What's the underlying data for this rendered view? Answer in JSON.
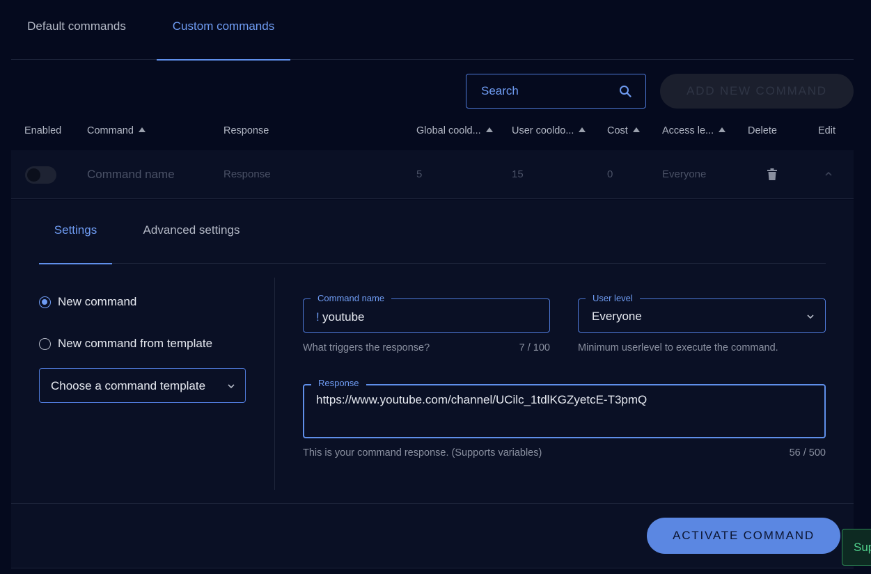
{
  "tabs": [
    "Default commands",
    "Custom commands"
  ],
  "search": {
    "placeholder": "Search"
  },
  "add_button": "ADD NEW COMMAND",
  "columns": [
    "Enabled",
    "Command",
    "Response",
    "Global coold...",
    "User cooldo...",
    "Cost",
    "Access le...",
    "Delete",
    "Edit"
  ],
  "row": {
    "enabled": false,
    "command": "Command name",
    "response": "Response",
    "global_cooldown": "5",
    "user_cooldown": "15",
    "cost": "0",
    "access_level": "Everyone"
  },
  "panel": {
    "tabs": [
      "Settings",
      "Advanced settings"
    ],
    "radio": {
      "new_command": "New command",
      "from_template": "New command from template",
      "selected": "new_command"
    },
    "template_select": "Choose a command template",
    "command_name": {
      "label": "Command name",
      "prefix": "!",
      "value": "youtube",
      "hint": "What triggers the response?",
      "counter": "7 / 100"
    },
    "user_level": {
      "label": "User level",
      "value": "Everyone",
      "hint": "Minimum userlevel to execute the command."
    },
    "response": {
      "label": "Response",
      "value": "https://www.youtube.com/channel/UCilc_1tdlKGZyetcE-T3pmQ",
      "hint": "This is your command response. (Supports variables)",
      "counter": "56 / 500"
    },
    "activate_button": "ACTIVATE COMMAND"
  },
  "support_button": "Sup",
  "colors": {
    "accent": "#5b87e2",
    "background": "#050a1e",
    "panel": "#0a1025",
    "support": "#51d08c"
  },
  "icons": [
    "search-icon",
    "trash-icon",
    "chevron-up-icon",
    "chevron-down-icon"
  ]
}
